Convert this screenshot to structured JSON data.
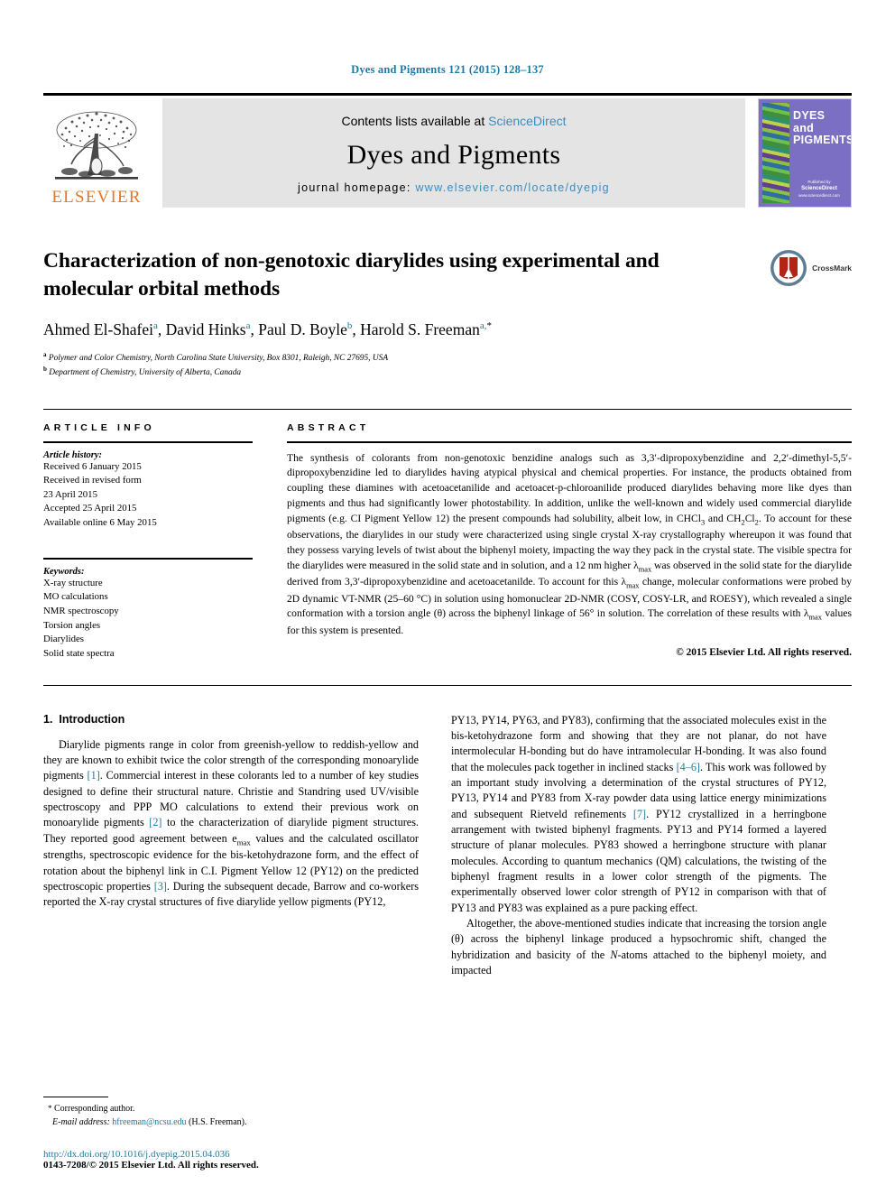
{
  "running_head": "Dyes and Pigments 121 (2015) 128–137",
  "masthead": {
    "publisher_name": "ELSEVIER",
    "contents_prefix": "Contents lists available at ",
    "contents_link": "ScienceDirect",
    "journal_title": "Dyes and Pigments",
    "homepage_prefix": "journal homepage: ",
    "homepage_url": "www.elsevier.com/locate/dyepig",
    "cover": {
      "line1": "DYES",
      "line2": "and",
      "line3": "PIGMENTS",
      "foot1": "Published by",
      "foot2": "ScienceDirect",
      "foot3": "www.sciencedirect.com"
    }
  },
  "article": {
    "title": "Characterization of non-genotoxic diarylides using experimental and molecular orbital methods",
    "crossmark_label": "CrossMark",
    "authors": [
      {
        "name": "Ahmed El-Shafei",
        "affil": "a",
        "sep": ", "
      },
      {
        "name": "David Hinks",
        "affil": "a",
        "sep": ", "
      },
      {
        "name": "Paul D. Boyle",
        "affil": "b",
        "sep": ", "
      },
      {
        "name": "Harold S. Freeman",
        "affil": "a,",
        "corr": "*",
        "sep": ""
      }
    ],
    "affiliations": [
      {
        "marker": "a",
        "text": "Polymer and Color Chemistry, North Carolina State University, Box 8301, Raleigh, NC 27695, USA"
      },
      {
        "marker": "b",
        "text": "Department of Chemistry, University of Alberta, Canada"
      }
    ]
  },
  "article_info": {
    "heading": "ARTICLE INFO",
    "history_label": "Article history:",
    "history": [
      "Received 6 January 2015",
      "Received in revised form",
      "23 April 2015",
      "Accepted 25 April 2015",
      "Available online 6 May 2015"
    ],
    "keywords_label": "Keywords:",
    "keywords": [
      "X-ray structure",
      "MO calculations",
      "NMR spectroscopy",
      "Torsion angles",
      "Diarylides",
      "Solid state spectra"
    ]
  },
  "abstract": {
    "heading": "ABSTRACT",
    "text_p1": "The synthesis of colorants from non-genotoxic benzidine analogs such as 3,3′-dipropoxybenzidine and 2,2′-dimethyl-5,5′-dipropoxybenzidine led to diarylides having atypical physical and chemical properties. For instance, the products obtained from coupling these diamines with acetoacetanilide and acetoacet-p-chloroanilide produced diarylides behaving more like dyes than pigments and thus had significantly lower photostability. In addition, unlike the well-known and widely used commercial diarylide pigments (e.g. CI Pigment Yellow 12) the present compounds had solubility, albeit low, in CHCl",
    "sub1": "3",
    "text_p2": " and CH",
    "sub2": "2",
    "text_p3": "Cl",
    "sub3": "2",
    "text_p4": ". To account for these observations, the diarylides in our study were characterized using single crystal X-ray crystallography whereupon it was found that they possess varying levels of twist about the biphenyl moiety, impacting the way they pack in the crystal state. The visible spectra for the diarylides were measured in the solid state and in solution, and a 12 nm higher λ",
    "sub4": "max",
    "text_p5": " was observed in the solid state for the diarylide derived from 3,3′-dipropoxybenzidine and acetoacetanilde. To account for this λ",
    "sub5": "max",
    "text_p6": " change, molecular conformations were probed by 2D dynamic VT-NMR (25–60 °C) in solution using homonuclear 2D-NMR (COSY, COSY-LR, and ROESY), which revealed a single conformation with a torsion angle (θ) across the biphenyl linkage of 56° in solution. The correlation of these results with λ",
    "sub6": "max",
    "text_p7": " values for this system is presented.",
    "copyright": "© 2015 Elsevier Ltd. All rights reserved."
  },
  "introduction": {
    "section_number": "1.",
    "section_title": "Introduction",
    "left_p1_a": "Diarylide pigments range in color from greenish-yellow to reddish-yellow and they are known to exhibit twice the color strength of the corresponding monoarylide pigments ",
    "left_ref1": "[1]",
    "left_p1_b": ". Commercial interest in these colorants led to a number of key studies designed to define their structural nature. Christie and Standring used UV/visible spectroscopy and PPP MO calculations to extend their previous work on monoarylide pigments ",
    "left_ref2": "[2]",
    "left_p1_c": " to the characterization of diarylide pigment structures. They reported good agreement between e",
    "left_sub1": "max",
    "left_p1_d": " values and the calculated oscillator strengths, spectroscopic evidence for the bis-ketohydrazone form, and the effect of rotation about the biphenyl link in C.I. Pigment Yellow 12 (PY12) on the predicted spectroscopic properties ",
    "left_ref3": "[3]",
    "left_p1_e": ". During the subsequent decade, Barrow and co-workers reported the X-ray crystal structures of five diarylide yellow pigments (PY12,",
    "right_p1_a": "PY13, PY14, PY63, and PY83), confirming that the associated molecules exist in the bis-ketohydrazone form and showing that they are not planar, do not have intermolecular H-bonding but do have intramolecular H-bonding. It was also found that the molecules pack together in inclined stacks ",
    "right_ref1": "[4–6]",
    "right_p1_b": ". This work was followed by an important study involving a determination of the crystal structures of PY12, PY13, PY14 and PY83 from X-ray powder data using lattice energy minimizations and subsequent Rietveld refinements ",
    "right_ref2": "[7]",
    "right_p1_c": ". PY12 crystallized in a herringbone arrangement with twisted biphenyl fragments. PY13 and PY14 formed a layered structure of planar molecules. PY83 showed a herringbone structure with planar molecules. According to quantum mechanics (QM) calculations, the twisting of the biphenyl fragment results in a lower color strength of the pigments. The experimentally observed lower color strength of PY12 in comparison with that of PY13 and PY83 was explained as a pure packing effect.",
    "right_p2_a": "Altogether, the above-mentioned studies indicate that increasing the torsion angle (θ) across the biphenyl linkage produced a hypsochromic shift, changed the hybridization and basicity of the ",
    "right_italic1": "N",
    "right_p2_b": "-atoms attached to the biphenyl moiety, and impacted"
  },
  "footer": {
    "corr_star": "*",
    "corr_text": "Corresponding author.",
    "email_label": "E-mail address:",
    "email": "hfreeman@ncsu.edu",
    "email_suffix": "(H.S. Freeman).",
    "doi": "http://dx.doi.org/10.1016/j.dyepig.2015.04.036",
    "issn": "0143-7208/© 2015 Elsevier Ltd. All rights reserved."
  },
  "colors": {
    "link_blue": "#1a7ba5",
    "sd_blue": "#3a8cbf",
    "elsevier_orange": "#E87722",
    "cover_purple": "#7b6fc4"
  }
}
